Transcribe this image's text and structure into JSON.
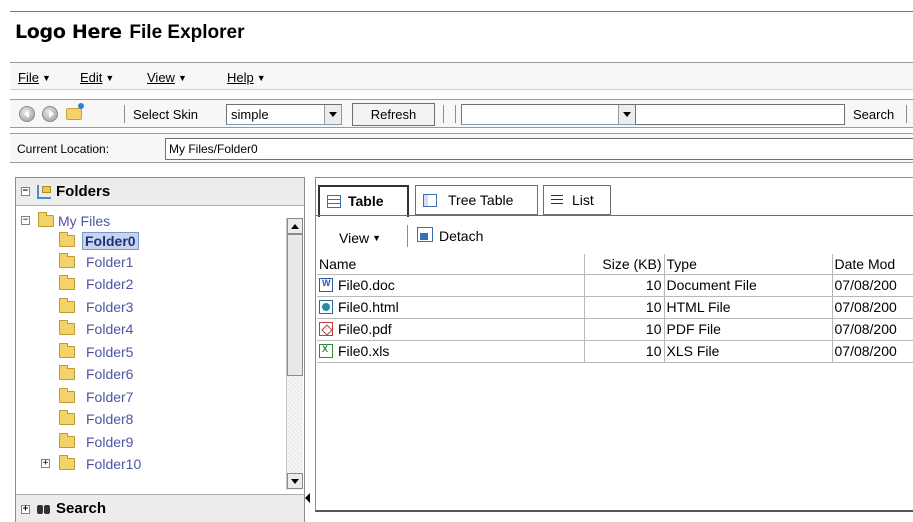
{
  "app": {
    "logo": "Logo Here",
    "title": "File Explorer"
  },
  "menubar": {
    "items": [
      "File",
      "Edit",
      "View",
      "Help"
    ]
  },
  "toolbar": {
    "icons": [
      "back-icon",
      "forward-icon",
      "up-folder-icon"
    ],
    "skin_label": "Select Skin",
    "skin_value": "simple",
    "refresh_label": "Refresh",
    "filter_value": "",
    "search_value": "",
    "search_label": "Search"
  },
  "location": {
    "label": "Current Location:",
    "value": "My Files/Folder0"
  },
  "left_pane": {
    "folders_header": "Folders",
    "search_header": "Search",
    "tree": {
      "root": "My Files",
      "selected": "Folder0",
      "folders": [
        "Folder0",
        "Folder1",
        "Folder2",
        "Folder3",
        "Folder4",
        "Folder5",
        "Folder6",
        "Folder7",
        "Folder8",
        "Folder9",
        "Folder10"
      ]
    }
  },
  "right_pane": {
    "tabs": [
      {
        "label": "Table",
        "icon": "table-icon",
        "active": true
      },
      {
        "label": "Tree Table",
        "icon": "tree-table-icon",
        "active": false
      },
      {
        "label": "List",
        "icon": "list-icon",
        "active": false
      }
    ],
    "toolbar": {
      "view_label": "View",
      "detach_label": "Detach"
    },
    "table": {
      "columns": [
        "Name",
        "Size (KB)",
        "Type",
        "Date Mod"
      ],
      "rows": [
        {
          "name": "File0.doc",
          "size": "10",
          "type": "Document File",
          "date": "07/08/200",
          "icon": "word-doc-icon"
        },
        {
          "name": "File0.html",
          "size": "10",
          "type": "HTML File",
          "date": "07/08/200",
          "icon": "html-file-icon"
        },
        {
          "name": "File0.pdf",
          "size": "10",
          "type": "PDF File",
          "date": "07/08/200",
          "icon": "pdf-file-icon"
        },
        {
          "name": "File0.xls",
          "size": "10",
          "type": "XLS File",
          "date": "07/08/200",
          "icon": "excel-file-icon"
        }
      ]
    }
  }
}
